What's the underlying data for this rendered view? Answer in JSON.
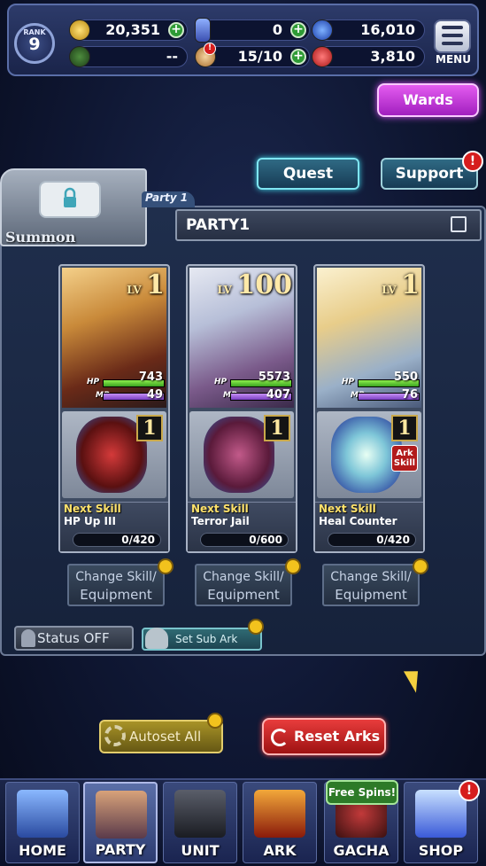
{
  "header": {
    "rank_label": "RANK",
    "rank_value": "9",
    "gil": "20,351",
    "crystals": "0",
    "orbs": "16,010",
    "empty_stat": "--",
    "stamina": "15/10",
    "red_orbs": "3,810",
    "menu_label": "MENU"
  },
  "buttons": {
    "wards": "Wards",
    "quest": "Quest",
    "support": "Support",
    "support_badge": "!",
    "status": "Status OFF",
    "sub_ark": "Set Sub Ark",
    "autoset": "Autoset All",
    "reset_arks": "Reset Arks"
  },
  "party": {
    "summon_label": "Summon",
    "tab_label": "Party 1",
    "name": "PARTY1"
  },
  "units": [
    {
      "lv_label": "LV",
      "lv": "1",
      "hp_label": "HP",
      "hp": "743",
      "mp_label": "MP",
      "mp": "49",
      "ark_lv": "1",
      "next_label": "Next Skill",
      "skill": "HP Up III",
      "progress": "0/420",
      "has_ark_skill": false
    },
    {
      "lv_label": "LV",
      "lv": "100",
      "hp_label": "HP",
      "hp": "5573",
      "mp_label": "MP",
      "mp": "407",
      "ark_lv": "1",
      "next_label": "Next Skill",
      "skill": "Terror Jail",
      "progress": "0/600",
      "has_ark_skill": false
    },
    {
      "lv_label": "LV",
      "lv": "1",
      "hp_label": "HP",
      "hp": "550",
      "mp_label": "MP",
      "mp": "76",
      "ark_lv": "1",
      "next_label": "Next Skill",
      "skill": "Heal Counter",
      "progress": "0/420",
      "has_ark_skill": true,
      "ark_skill_label": "Ark Skill"
    }
  ],
  "change_skill": {
    "line1": "Change Skill/",
    "line2": "Equipment"
  },
  "nav": {
    "items": [
      "HOME",
      "PARTY",
      "UNIT",
      "ARK",
      "GACHA",
      "SHOP"
    ],
    "free_spins": "Free Spins!",
    "shop_badge": "!"
  },
  "colors": {
    "accent_magenta": "#c43ae0",
    "accent_cyan": "#42d8ea",
    "reset_red": "#d12828",
    "gold": "#c9a84a"
  }
}
